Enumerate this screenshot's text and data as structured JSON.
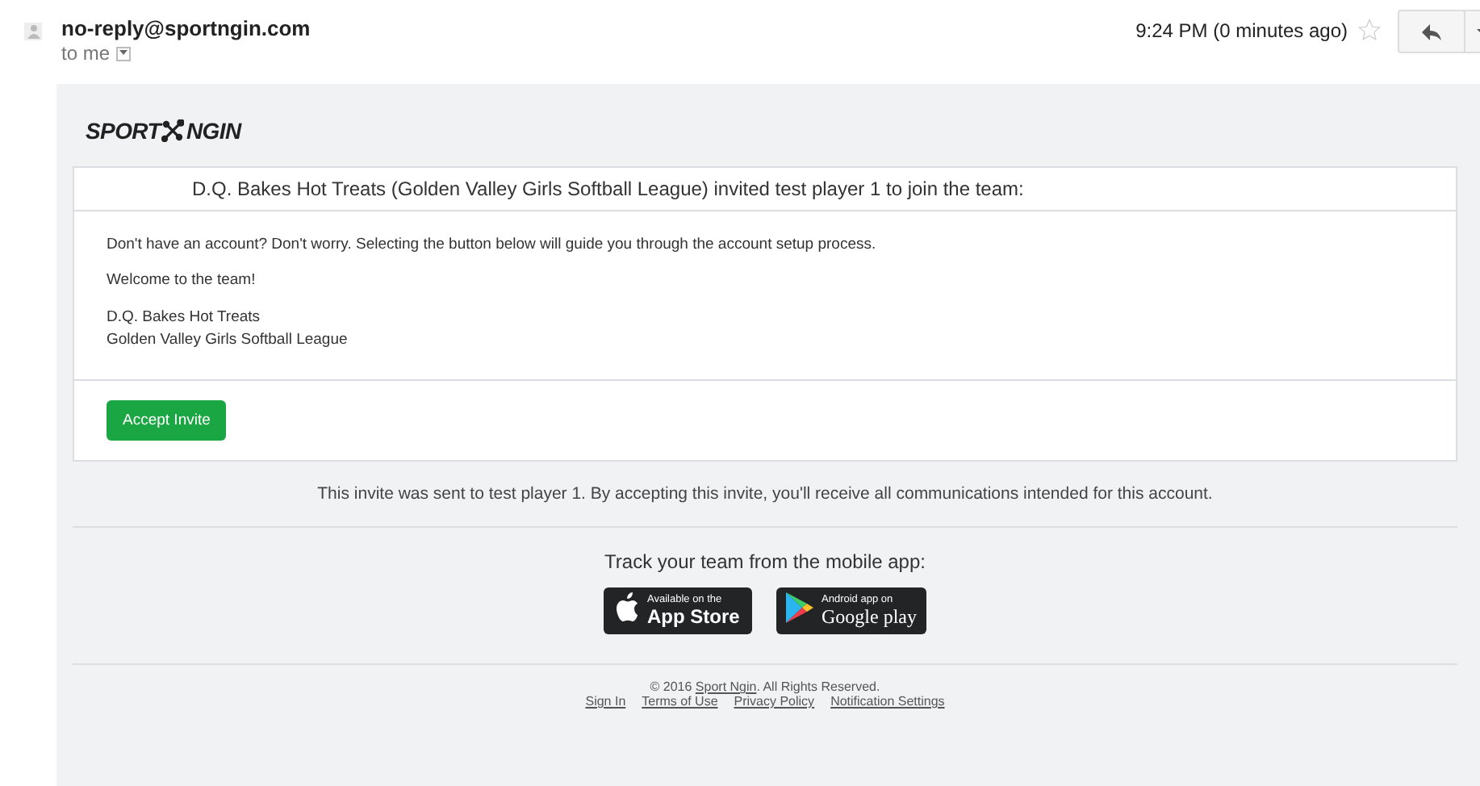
{
  "header": {
    "sender": "no-reply@sportngin.com",
    "recipient": "to me",
    "time": "9:24 PM (0 minutes ago)",
    "starred": false
  },
  "logo": {
    "left": "SPORT",
    "right": "NGIN"
  },
  "card": {
    "headline": "D.Q. Bakes Hot Treats (Golden Valley Girls Softball League) invited test player 1 to join the team:",
    "paragraphs": [
      "Don't have an account? Don't worry. Selecting the button below will guide you through the account setup process.",
      "Welcome to the team!"
    ],
    "signature": [
      "D.Q. Bakes Hot Treats",
      "Golden Valley Girls Softball League"
    ],
    "button": "Accept Invite"
  },
  "notice": "This invite was sent to test player 1. By accepting this invite, you'll receive all communications intended for this account.",
  "apps": {
    "title": "Track your team from the mobile app:",
    "badges": [
      {
        "kind": "apple",
        "small": "Available on the",
        "big": "App Store"
      },
      {
        "kind": "google",
        "small": "Android app on",
        "big": "Google play"
      }
    ]
  },
  "footer": {
    "copyright": {
      "before": "© 2016 ",
      "link": "Sport Ngin",
      "after": ". All Rights Reserved."
    },
    "links": [
      "Sign In",
      "Terms of Use",
      "Privacy Policy",
      "Notification Settings"
    ]
  }
}
